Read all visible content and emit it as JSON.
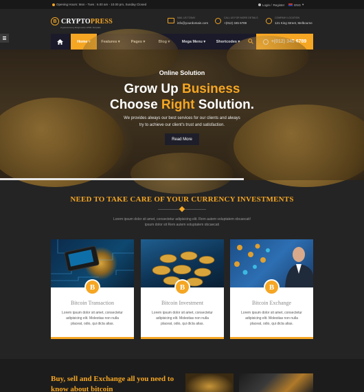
{
  "topbar": {
    "hours": "Opening Hours: Mon - Tues : 6.00 am - 10.00 pm, Sunday Closed",
    "login": "Login /",
    "register": "Register",
    "language": "ENG"
  },
  "header": {
    "logo_part1": "CRYPTO",
    "logo_part2": "PRESS",
    "logo_coin": "B",
    "tagline": "Cryptocurrency Responsive HTML Template",
    "mail_label": "MAIL US TODAY",
    "mail_value": "info@yourdomain.com",
    "call_label": "CALL US FOR MORE DETAILS",
    "call_value": "+(012) 345 6789",
    "location_label": "COMPANY LOCATION",
    "location_value": "121 King Street, Melbourne"
  },
  "nav": {
    "items": [
      "Home",
      "Features",
      "Pages",
      "Blog",
      "Mega Menu",
      "Shortcodes"
    ],
    "phone": "+(012) 345 6789"
  },
  "hero": {
    "subtitle": "Online Solution",
    "title_line1_a": "Grow Up ",
    "title_line1_b": "Business",
    "title_line2_a": "Choose ",
    "title_line2_b": "Right",
    "title_line2_c": " Solution.",
    "desc_line1": "We provides always our best services for our clients and always",
    "desc_line2": "try to achieve our client's trust and satisfaction.",
    "button": "Read More",
    "progress": 0.67
  },
  "section": {
    "title": "NEED TO TAKE CARE OF YOUR CURRENCY INVESTMENTS",
    "desc_line1": "Lorem ipsum dolor sit amet, consectetur adipisicing elit. Rem autem voluptatem obcaecati!",
    "desc_line2": "ipsum dolor sit Rem autem voluptatem obcaecati"
  },
  "cards": [
    {
      "title": "Bitcoin Transaction",
      "text": "Lorem ipsum dolor sit amet, consectetur adipisicing elit. Molestias non nulla placeat, odio, qui dicta alias."
    },
    {
      "title": "Bitcoin Investment",
      "text": "Lorem ipsum dolor sit amet, consectetur adipisicing elit. Molestias non nulla placeat, odio, qui dicta alias."
    },
    {
      "title": "Bitcoin Exchange",
      "text": "Lorem ipsum dolor sit amet, consectetur adipisicing elit. Molestias non nulla placeat, odio, qui dicta alias."
    }
  ],
  "card_coin": "B",
  "bottom": {
    "title": "Buy, sell and Exchange all you need to know about bitcoin"
  },
  "colors": {
    "accent": "#f5a623",
    "background": "#242424",
    "nav": "#1a1a2a"
  }
}
